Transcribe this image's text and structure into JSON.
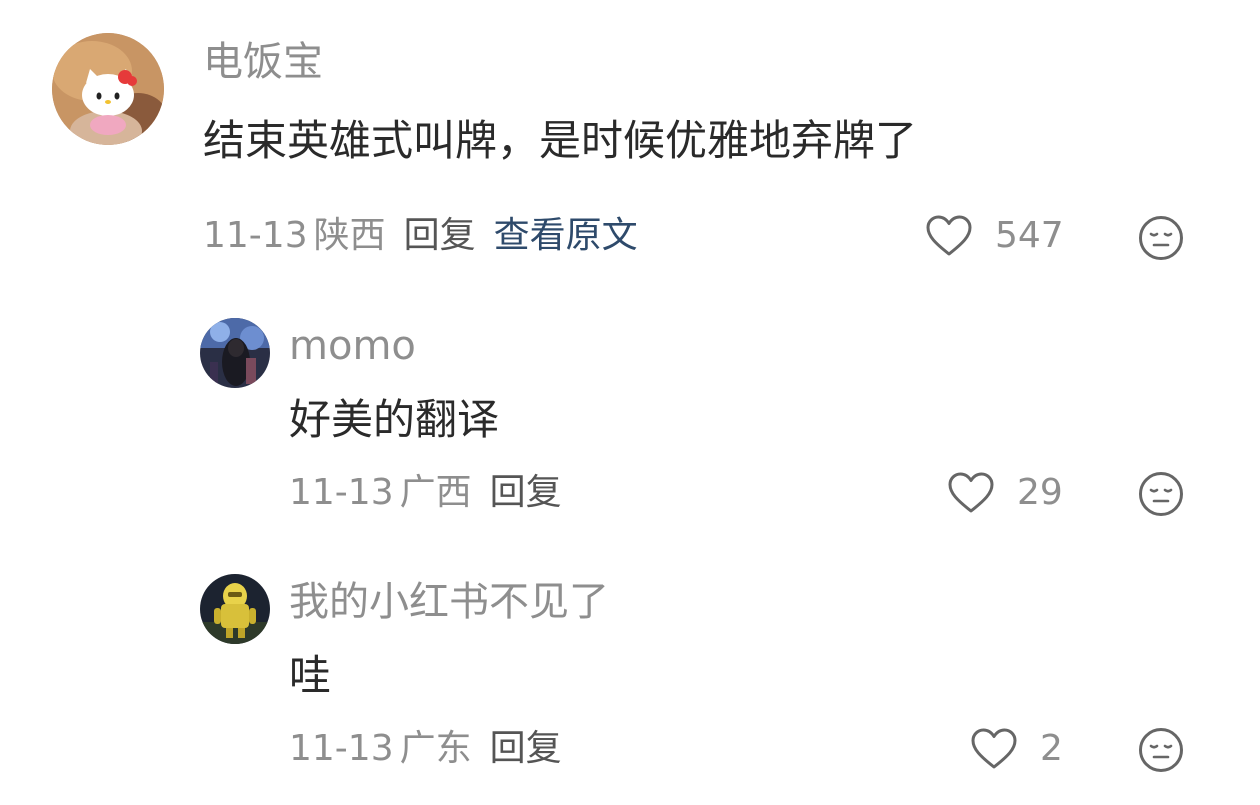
{
  "comments": [
    {
      "username": "电饭宝",
      "text": "结束英雄式叫牌，是时候优雅地弃牌了",
      "date": "11-13",
      "location": "陕西",
      "reply_label": "回复",
      "view_original_label": "查看原文",
      "likes": "547",
      "avatar_icon": "hello-kitty-avatar"
    },
    {
      "username": "momo",
      "text": "好美的翻译",
      "date": "11-13",
      "location": "广西",
      "reply_label": "回复",
      "likes": "29",
      "avatar_icon": "dark-photo-avatar"
    },
    {
      "username": "我的小红书不见了",
      "text": "哇",
      "date": "11-13",
      "location": "广东",
      "reply_label": "回复",
      "likes": "2",
      "avatar_icon": "yellow-robot-avatar"
    }
  ],
  "icons": {
    "like": "heart-outline-icon",
    "reaction": "neutral-face-icon"
  },
  "colors": {
    "username": "#8e8e8e",
    "body_text": "#2a2a2a",
    "meta_text": "#8e8e8e",
    "view_original": "#2e4a6b",
    "icon_stroke": "#666666"
  }
}
